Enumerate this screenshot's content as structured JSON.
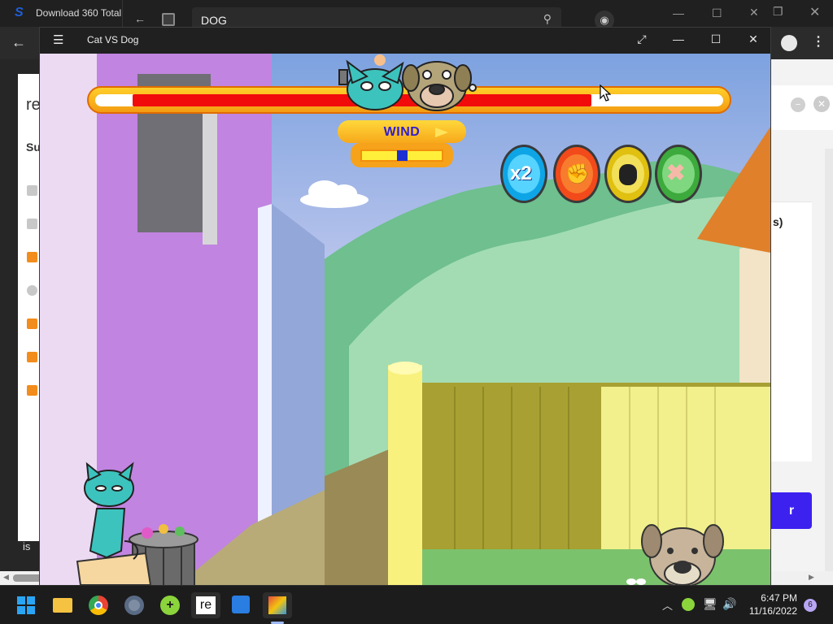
{
  "background_windows": {
    "browser_title": "Download 360 Total",
    "store_search_value": "DOG",
    "page_left_text": "re",
    "page_left_s": "Su",
    "page_left_is": "is",
    "page_right_partial": "s)",
    "page_right_button": "r"
  },
  "game": {
    "window_title": "Cat VS Dog",
    "wind_label": "WIND",
    "wind_level": 0.5,
    "power_fill_start": 0.06,
    "power_fill_end": 0.79,
    "powerups": [
      {
        "name": "double-damage",
        "label": "x2",
        "color": "#0ea5e6"
      },
      {
        "name": "power-punch",
        "label": "",
        "color": "#f24a1a"
      },
      {
        "name": "gas-mask",
        "label": "",
        "color": "#e0c010"
      },
      {
        "name": "bandage-heal",
        "label": "",
        "color": "#3caa3c"
      }
    ]
  },
  "taskbar": {
    "time": "6:47 PM",
    "date": "11/16/2022",
    "notification_count": "6",
    "apps": [
      "windows-start",
      "file-explorer",
      "chrome",
      "settings",
      "360-total-security",
      "reverso",
      "microsoft-store",
      "cat-vs-dog-game"
    ]
  }
}
